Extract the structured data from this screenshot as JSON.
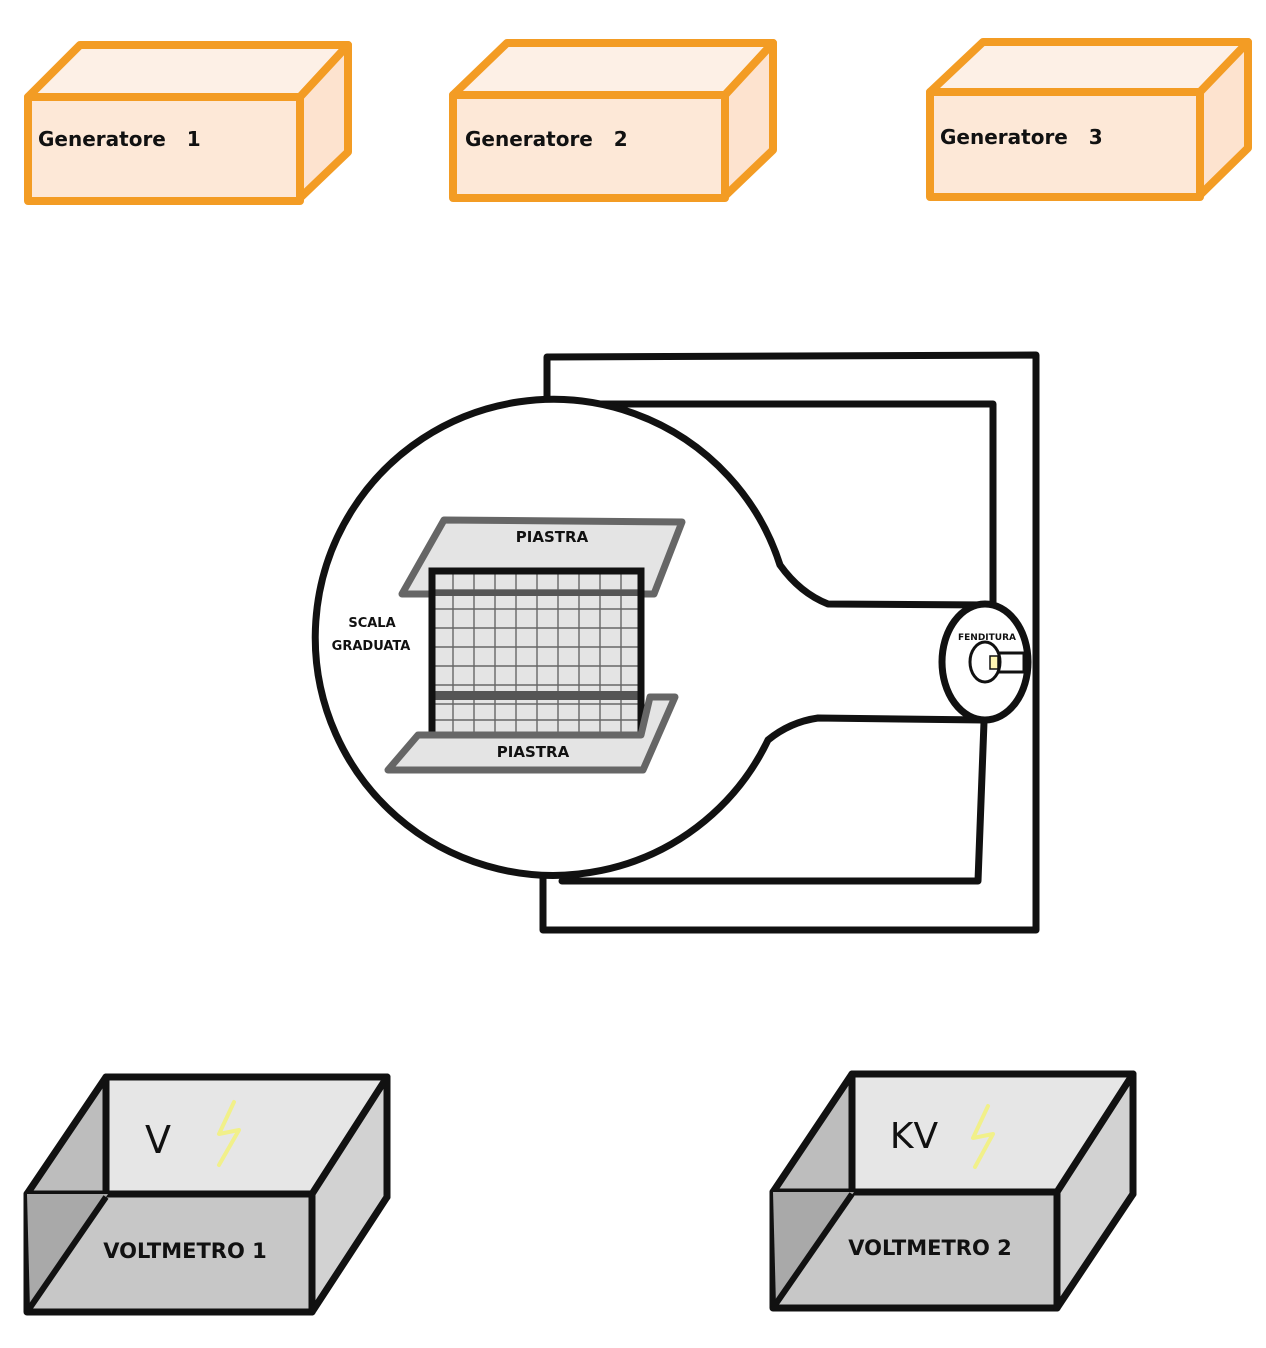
{
  "generators": [
    {
      "label": "Generatore   1"
    },
    {
      "label": "Generatore   2"
    },
    {
      "label": "Generatore   3"
    }
  ],
  "tube": {
    "plate_top": "PIASTRA",
    "plate_bottom": "PIASTRA",
    "scale_line1": "SCALA",
    "scale_line2": "GRADUATA",
    "slit": "FENDITURA"
  },
  "voltmeters": [
    {
      "label": "VOLTMETRO 1",
      "unit": "V"
    },
    {
      "label": "VOLTMETRO 2",
      "unit": "KV"
    }
  ],
  "colors": {
    "generator_stroke": "#f39c24",
    "generator_fill": "#fde8d7",
    "voltmeter_stroke": "#111111",
    "voltmeter_light": "#e6e6e6",
    "voltmeter_dark": "#a9a9a9",
    "plate_fill": "#e4e4e4",
    "lightning": "#f1f08a"
  },
  "icons": [
    "lightning-icon"
  ]
}
